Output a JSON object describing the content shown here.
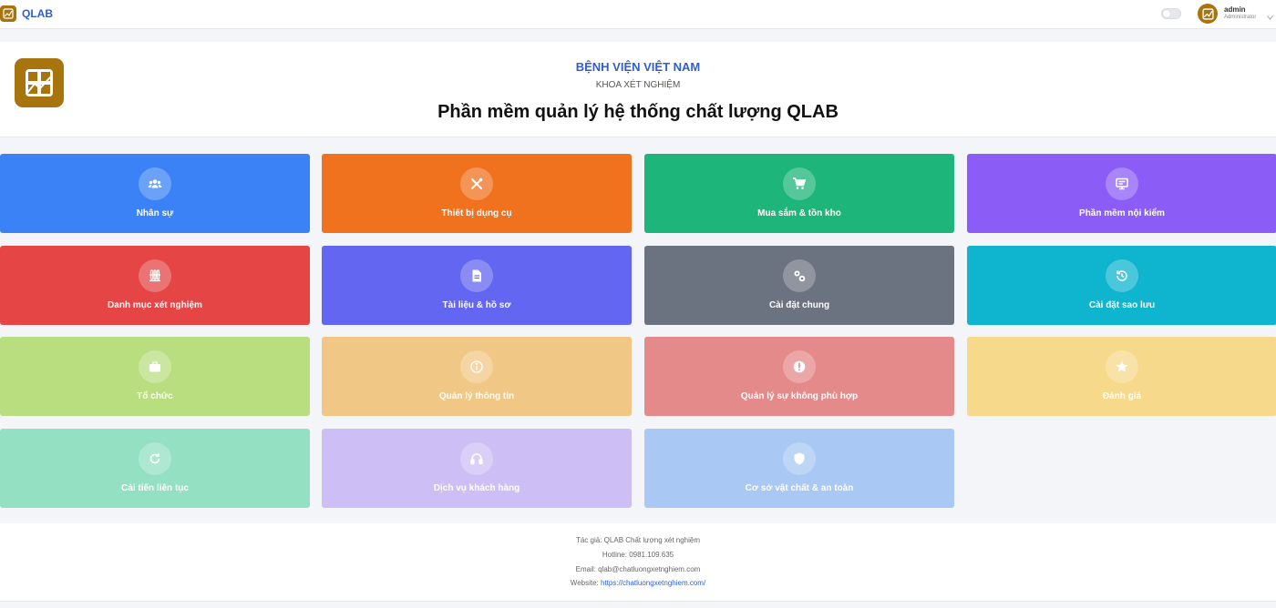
{
  "topbar": {
    "brand": "QLAB",
    "user": {
      "name": "admin",
      "role": "Administrator"
    }
  },
  "header": {
    "hospital": "BỆNH VIỆN VIỆT NAM",
    "department": "KHOA XÉT NGHIỆM",
    "title": "Phần mềm quản lý hệ thống chất lượng QLAB"
  },
  "tiles": [
    {
      "label": "Nhân sự",
      "icon": "users-icon",
      "color": "#3b82f6"
    },
    {
      "label": "Thiết bị dụng cụ",
      "icon": "tools-icon",
      "color": "#f0721f"
    },
    {
      "label": "Mua sắm & tồn kho",
      "icon": "cart-icon",
      "color": "#1db57a"
    },
    {
      "label": "Phần mềm nội kiểm",
      "icon": "monitor-icon",
      "color": "#8b5cf6"
    },
    {
      "label": "Danh mục xét nghiệm",
      "icon": "test-tubes-icon",
      "color": "#e54545"
    },
    {
      "label": "Tài liệu & hồ sơ",
      "icon": "document-icon",
      "color": "#6366f1"
    },
    {
      "label": "Cài đặt chung",
      "icon": "gears-icon",
      "color": "#6b7280"
    },
    {
      "label": "Cài đặt sao lưu",
      "icon": "backup-icon",
      "color": "#0fb4cf"
    },
    {
      "label": "Tổ chức",
      "icon": "briefcase-icon",
      "color": "#b9de80"
    },
    {
      "label": "Quản lý thông tin",
      "icon": "info-icon",
      "color": "#f1c785"
    },
    {
      "label": "Quản lý sự không phù hợp",
      "icon": "alert-icon",
      "color": "#e58a8a"
    },
    {
      "label": "Đánh giá",
      "icon": "star-icon",
      "color": "#f6d98a"
    },
    {
      "label": "Cải tiến liên tục",
      "icon": "refresh-icon",
      "color": "#93e0c3"
    },
    {
      "label": "Dịch vụ khách hàng",
      "icon": "headset-icon",
      "color": "#cdbff5"
    },
    {
      "label": "Cơ sở vật chất & an toàn",
      "icon": "shield-icon",
      "color": "#a9c8f3"
    }
  ],
  "footer": {
    "author": "Tác giả: QLAB Chất lượng xét nghiệm",
    "hotline": "Hotline: 0981.109.635",
    "email": "Email: qlab@chatluongxetnghiem.com",
    "website_label": "Website: ",
    "website_url": "https://chatluongxetnghiem.com/"
  }
}
